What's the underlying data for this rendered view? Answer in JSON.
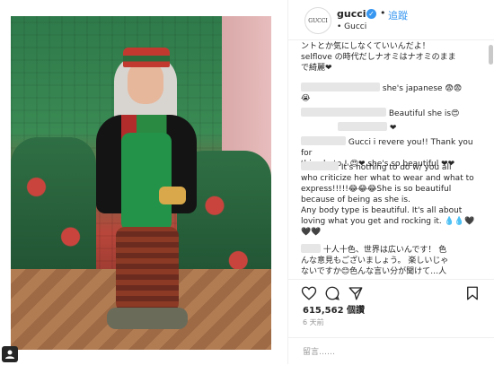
{
  "header": {
    "avatar_text": "GUCCI",
    "username": "gucci",
    "verified_icon": "verified-check-icon",
    "separator": "•",
    "follow_label": "追蹤",
    "subtitle": "• Gucci"
  },
  "comments": [
    {
      "text_lines": [
        "ントとか気にしなくていいんだよ！",
        "selflove の時代だしナオミはナオミのまま",
        "で綺麗❤"
      ]
    },
    {
      "text": "she's japanese 😨😨"
    },
    {
      "text": "😭"
    },
    {
      "text": "Beautiful she is😍"
    },
    {
      "text": "❤"
    },
    {
      "text_lines": [
        "Gucci i revere you!! Thank you for",
        "this photo ! 😍❤ she's so beautiful ❤❤"
      ]
    },
    {
      "text_lines": [
        "It's nothing to do w/ you all",
        "who criticize her what to wear and what to",
        "express!!!!!😂😂😂She is so beautiful",
        "because of being as she is.",
        "Any body type is beautiful. It's all about",
        "loving what you get and rocking it. 💧💧🖤",
        "🖤🖤"
      ]
    },
    {
      "text_lines": [
        "十人十色、世界は広いんです！  色",
        "んな意見もございましょう。  楽しいじゃ",
        "ないですか😊色んな言い分が聞けて…人"
      ]
    }
  ],
  "likes": "615,562 個讚",
  "time": "6 天前",
  "comment_placeholder": "留言……",
  "icons": [
    "heart-outline-icon",
    "comment-icon",
    "share-icon",
    "bookmark-icon"
  ],
  "colors": {
    "accent": "#3897f0",
    "border": "#efefef",
    "text": "#262626",
    "muted": "#999999"
  }
}
